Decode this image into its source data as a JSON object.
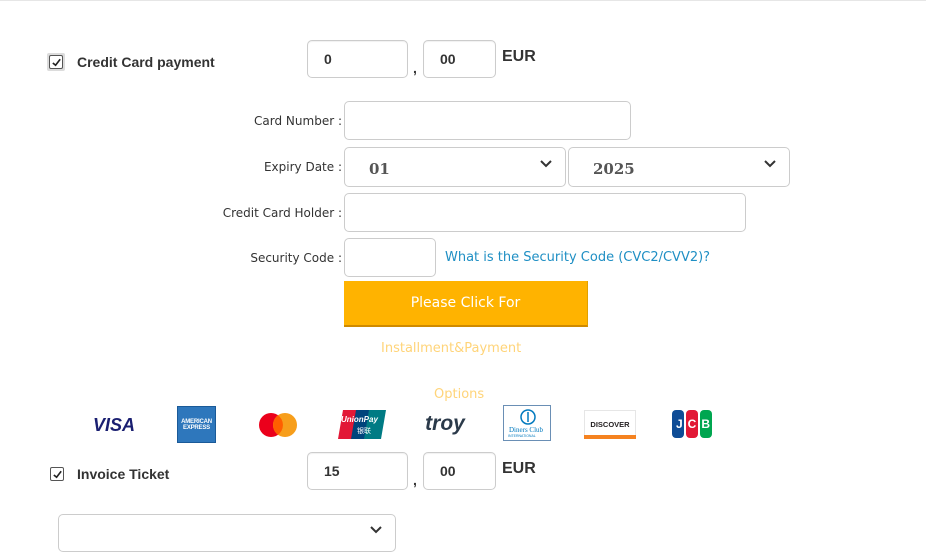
{
  "credit_card": {
    "label": "Credit Card payment",
    "checked": true,
    "amount_whole": "0",
    "amount_cents": "00",
    "separator": ",",
    "currency": "EUR"
  },
  "form": {
    "card_number_label": "Card Number :",
    "expiry_label": "Expiry Date :",
    "expiry_month": "01",
    "expiry_year": "2025",
    "holder_label": "Credit Card Holder :",
    "security_label": "Security Code :",
    "security_link": "What is the Security Code (CVC2/CVV2)?",
    "submit_label": "Please Click For",
    "submit_sub1": "Installment&Payment",
    "submit_sub2": "Options"
  },
  "card_logos": {
    "visa": "VISA",
    "amex_line1": "AMERICAN",
    "amex_line2": "EXPRESS",
    "unionpay_line1": "UnionPay",
    "unionpay_line2": "银联",
    "troy": "troy",
    "diners_line1": "Diners Club",
    "diners_line2": "INTERNATIONAL",
    "discover": "DISCOVER",
    "jcb": "JCB"
  },
  "invoice": {
    "label": "Invoice Ticket",
    "checked": true,
    "amount_whole": "15",
    "amount_cents": "00",
    "separator": ",",
    "currency": "EUR",
    "select_value": ""
  },
  "colors": {
    "accent_button": "#ffb300",
    "link": "#1f8fc4",
    "faint_text": "#ffd479"
  }
}
